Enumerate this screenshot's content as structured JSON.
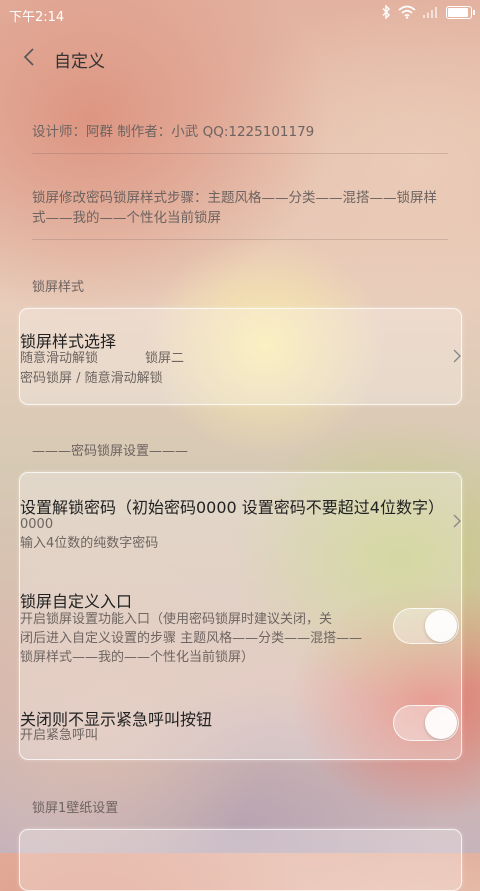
{
  "status_bar": {
    "time": "下午2:14",
    "icons": [
      "bluetooth-icon",
      "wifi-icon",
      "signal-icon",
      "battery-icon"
    ]
  },
  "header": {
    "title": "自定义",
    "back_icon": "back-arrow-icon"
  },
  "info": {
    "credits": "设计师：阿群  制作者：小武 QQ:1225101179",
    "steps": "锁屏修改密码锁屏样式步骤：主题风格——分类——混搭——锁屏样式——我的——个性化当前锁屏"
  },
  "sections": {
    "lock_style": "锁屏样式",
    "password_settings": "———密码锁屏设置———",
    "wallpaper": "锁屏1壁纸设置"
  },
  "lock_style_card": {
    "title": "锁屏样式选择",
    "line1_left": "随意滑动解锁",
    "line1_right": "锁屏二",
    "line2": "密码锁屏 / 随意滑动解锁"
  },
  "password_card": {
    "set_password": {
      "title": "设置解锁密码（初始密码0000  设置密码不要超过4位数字）",
      "value": "0000",
      "hint": "输入4位数的纯数字密码"
    },
    "custom_entry": {
      "title": "锁屏自定义入口",
      "desc_line1": "开启锁屏设置功能入口（使用密码锁屏时建议关闭，关",
      "desc_line2": "闭后进入自定义设置的步骤   主题风格——分类——混搭——",
      "desc_line3": "锁屏样式——我的——个性化当前锁屏）",
      "enabled": true
    },
    "emergency": {
      "title": "关闭则不显示紧急呼叫按钮",
      "desc": "开启紧急呼叫",
      "enabled": true
    }
  },
  "colors": {
    "title_text": "#222222",
    "secondary_text": "#6e6560",
    "card_border": "#ffffff"
  }
}
